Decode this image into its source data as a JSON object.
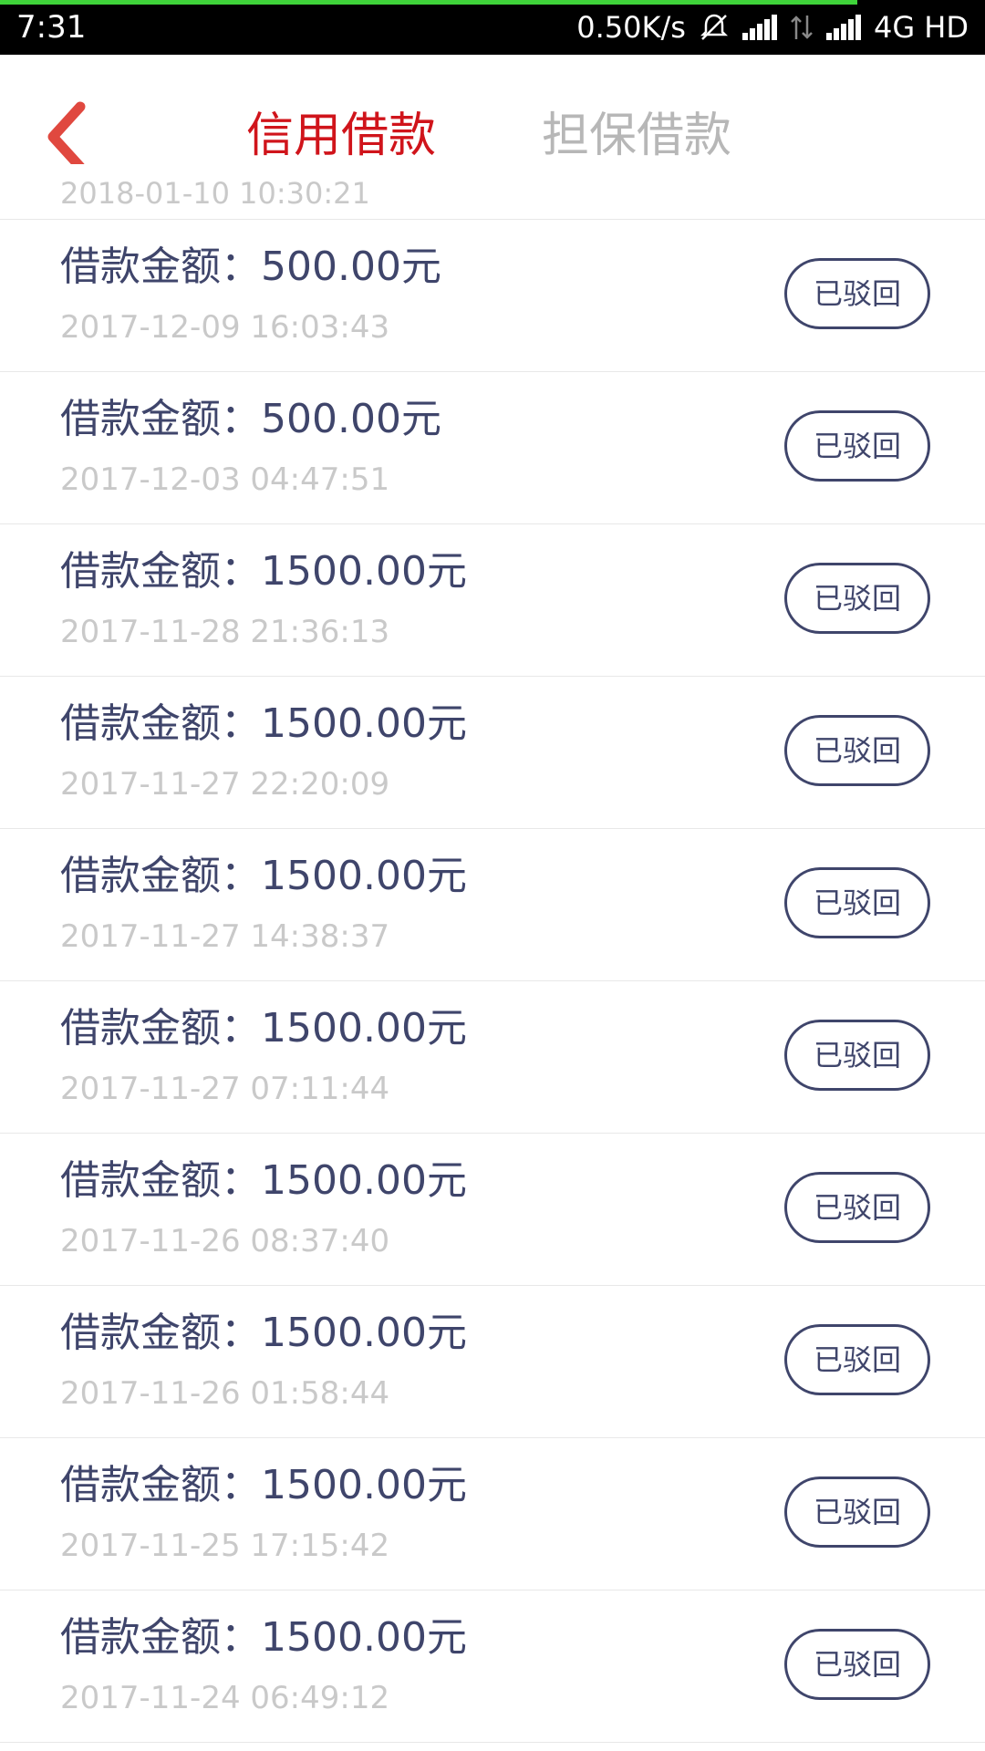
{
  "status_bar": {
    "time": "7:31",
    "speed": "0.50K/s",
    "network": "4G HD",
    "icons": [
      "mute-bell-icon",
      "signal-icon",
      "data-arrows-icon",
      "signal-icon"
    ]
  },
  "header": {
    "tabs": [
      {
        "label": "信用借款",
        "active": true
      },
      {
        "label": "担保借款",
        "active": false
      }
    ],
    "accent_color": "#d0141b"
  },
  "list": {
    "peek_text": "2018-01-10 10:30:21",
    "items": [
      {
        "amount": "借款金额：500.00元",
        "date": "2017-12-09 16:03:43",
        "status": "已驳回"
      },
      {
        "amount": "借款金额：500.00元",
        "date": "2017-12-03 04:47:51",
        "status": "已驳回"
      },
      {
        "amount": "借款金额：1500.00元",
        "date": "2017-11-28 21:36:13",
        "status": "已驳回"
      },
      {
        "amount": "借款金额：1500.00元",
        "date": "2017-11-27 22:20:09",
        "status": "已驳回"
      },
      {
        "amount": "借款金额：1500.00元",
        "date": "2017-11-27 14:38:37",
        "status": "已驳回"
      },
      {
        "amount": "借款金额：1500.00元",
        "date": "2017-11-27 07:11:44",
        "status": "已驳回"
      },
      {
        "amount": "借款金额：1500.00元",
        "date": "2017-11-26 08:37:40",
        "status": "已驳回"
      },
      {
        "amount": "借款金额：1500.00元",
        "date": "2017-11-26 01:58:44",
        "status": "已驳回"
      },
      {
        "amount": "借款金额：1500.00元",
        "date": "2017-11-25 17:15:42",
        "status": "已驳回"
      },
      {
        "amount": "借款金额：1500.00元",
        "date": "2017-11-24 06:49:12",
        "status": "已驳回"
      }
    ]
  }
}
